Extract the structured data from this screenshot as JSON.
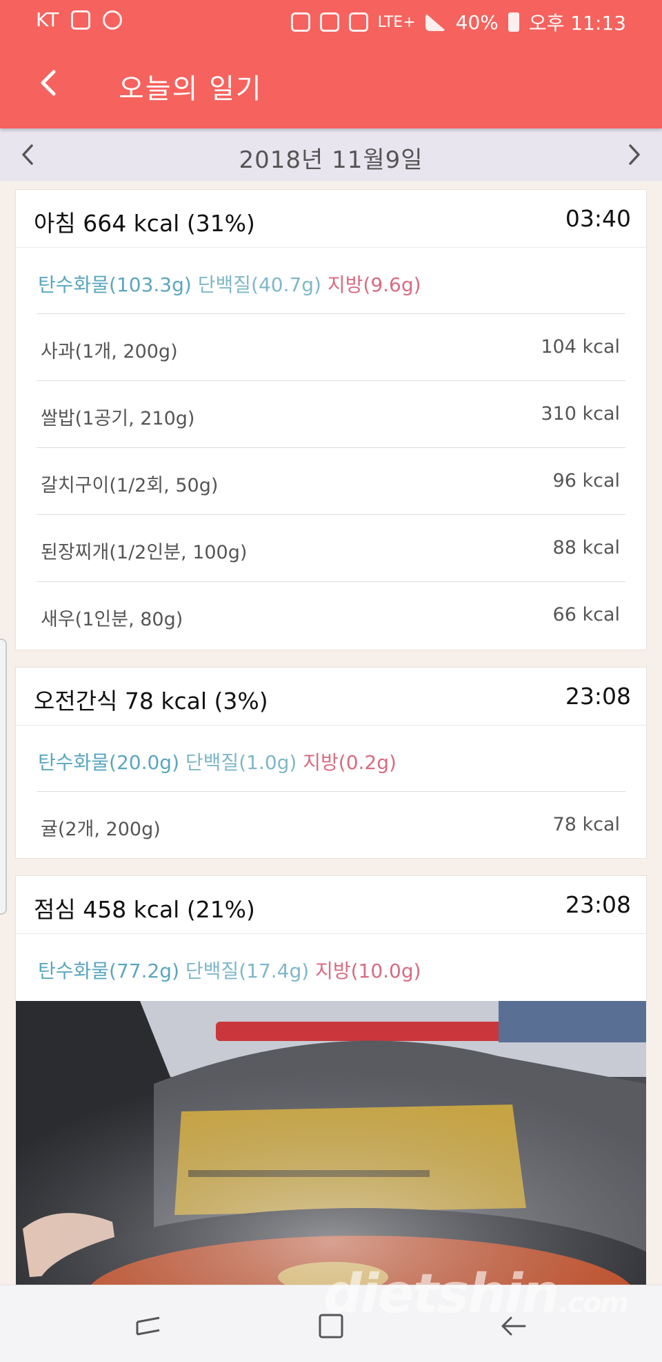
{
  "status": {
    "carrier": "KT",
    "network": "LTE+",
    "battery": "40%",
    "time": "오후 11:13"
  },
  "header": {
    "title": "오늘의 일기"
  },
  "date_nav": {
    "date": "2018년 11월9일"
  },
  "meals": [
    {
      "title": "아침 664 kcal (31%)",
      "time": "03:40",
      "carb": "탄수화물(103.3g)",
      "protein": "단백질(40.7g)",
      "fat": "지방(9.6g)",
      "foods": [
        {
          "name": "사과(1개, 200g)",
          "kcal": "104 kcal"
        },
        {
          "name": "쌀밥(1공기, 210g)",
          "kcal": "310 kcal"
        },
        {
          "name": "갈치구이(1/2회, 50g)",
          "kcal": "96 kcal"
        },
        {
          "name": "된장찌개(1/2인분, 100g)",
          "kcal": "88 kcal"
        },
        {
          "name": "새우(1인분, 80g)",
          "kcal": "66 kcal"
        }
      ]
    },
    {
      "title": "오전간식 78 kcal (3%)",
      "time": "23:08",
      "carb": "탄수화물(20.0g)",
      "protein": "단백질(1.0g)",
      "fat": "지방(0.2g)",
      "foods": [
        {
          "name": "귤(2개, 200g)",
          "kcal": "78 kcal"
        }
      ]
    },
    {
      "title": "점심 458 kcal (21%)",
      "time": "23:08",
      "carb": "탄수화물(77.2g)",
      "protein": "단백질(17.4g)",
      "fat": "지방(10.0g)",
      "foods": []
    }
  ],
  "watermark": {
    "main": "dietshin",
    "suffix": ".com"
  },
  "colors": {
    "header_bg": "#f6625d",
    "datebar_bg": "#e8e5ef",
    "carb": "#5aa6bf",
    "protein": "#7fb7c9",
    "fat": "#d96b80"
  }
}
